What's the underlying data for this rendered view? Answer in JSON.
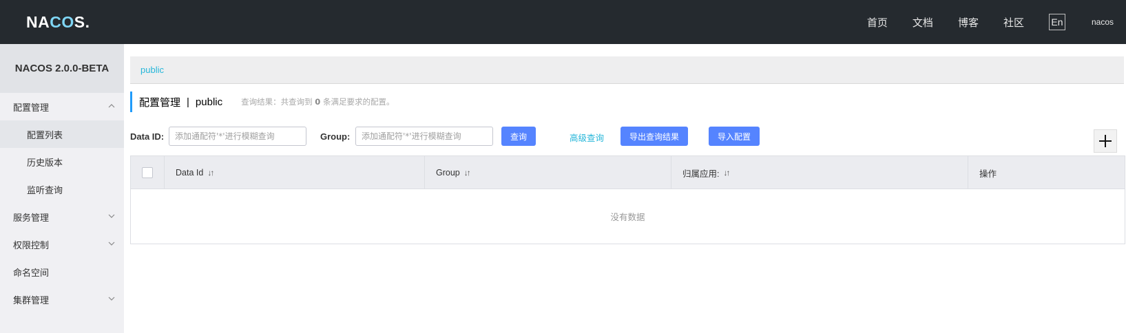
{
  "header": {
    "logo_prefix": "NA",
    "logo_mid": "CO",
    "logo_suffix": "S.",
    "nav": [
      "首页",
      "文档",
      "博客",
      "社区"
    ],
    "lang_button": "En",
    "username": "nacos"
  },
  "sidebar": {
    "title": "NACOS 2.0.0-BETA",
    "items": [
      {
        "label": "配置管理",
        "level": 1,
        "expanded": true
      },
      {
        "label": "配置列表",
        "level": 2,
        "active": true
      },
      {
        "label": "历史版本",
        "level": 2
      },
      {
        "label": "监听查询",
        "level": 2
      },
      {
        "label": "服务管理",
        "level": 1,
        "expanded": false
      },
      {
        "label": "权限控制",
        "level": 1,
        "expanded": false
      },
      {
        "label": "命名空间",
        "level": 1
      },
      {
        "label": "集群管理",
        "level": 1,
        "expanded": false
      }
    ]
  },
  "namespace_bar": {
    "current": "public"
  },
  "page_header": {
    "title": "配置管理",
    "separator": "|",
    "namespace": "public",
    "result_prefix": "查询结果：共查询到",
    "result_count": "0",
    "result_suffix": "条满足要求的配置。"
  },
  "search": {
    "data_id_label": "Data ID:",
    "data_id_placeholder": "添加通配符'*'进行模糊查询",
    "group_label": "Group:",
    "group_placeholder": "添加通配符'*'进行模糊查询",
    "query_button": "查询",
    "advanced_link": "高级查询",
    "export_button": "导出查询结果",
    "import_button": "导入配置"
  },
  "table": {
    "columns": [
      "Data Id",
      "Group",
      "归属应用:",
      "操作"
    ],
    "empty_text": "没有数据"
  },
  "colors": {
    "header_bg": "#252a2f",
    "accent": "#5584ff",
    "link": "#25b6d9"
  }
}
